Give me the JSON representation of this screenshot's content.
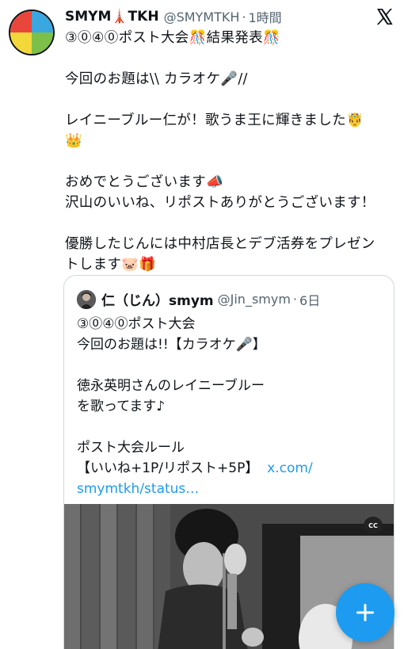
{
  "author": {
    "display_name": "SMYM🗼TKH",
    "handle": "@SMYMTKH",
    "separator": "·",
    "time": "1時間"
  },
  "tweet_lines": [
    "③⓪④⓪ポスト大会🎊結果発表🎊",
    "",
    "今回のお題は\\\\ カラオケ🎤//",
    "",
    "レイニーブルー仁が！歌うま王に輝きました🤴",
    "👑",
    "",
    "おめでとうございます📣",
    "沢山のいいね、リポストありがとうございます！",
    "",
    "優勝したじんには中村店長とデブ活券をプレゼン",
    "トします🐷🎁"
  ],
  "quoted": {
    "display_name": "仁（じん）smym",
    "handle": "@Jin_smym",
    "separator": "·",
    "time": "6日",
    "lines": [
      "③⓪④⓪ポスト大会",
      "今回のお題は!!【カラオケ🎤】",
      "",
      "徳永英明さんのレイニーブルー",
      "を歌ってます♪",
      "",
      "ポスト大会ルール",
      "【いいね+1P/リポスト+5P】"
    ],
    "link_part1": "x.com/",
    "link_part2": "smymtkh/status…",
    "cc_label": "CC"
  },
  "icons": {
    "x_logo": "x-logo-icon",
    "compose": "plus-icon",
    "captions": "cc-icon"
  },
  "colors": {
    "link": "#1d9bf0",
    "fab": "#1d9bf0",
    "secondary_text": "#536471"
  }
}
